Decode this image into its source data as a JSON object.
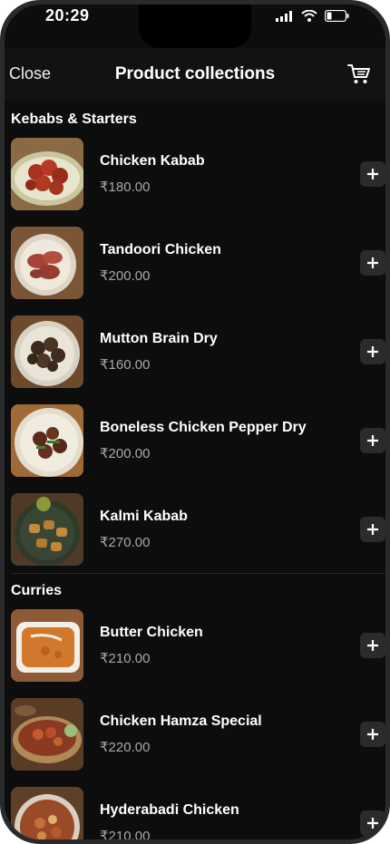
{
  "status_bar": {
    "time": "20:29"
  },
  "header": {
    "close_label": "Close",
    "title": "Product collections",
    "cart_icon": "cart-icon"
  },
  "sections": [
    {
      "title": "Kebabs & Starters",
      "items": [
        {
          "name": "Chicken Kabab",
          "price": "₹180.00"
        },
        {
          "name": "Tandoori Chicken",
          "price": "₹200.00"
        },
        {
          "name": "Mutton Brain Dry",
          "price": "₹160.00"
        },
        {
          "name": "Boneless Chicken Pepper Dry",
          "price": "₹200.00"
        },
        {
          "name": "Kalmi Kabab",
          "price": "₹270.00"
        }
      ]
    },
    {
      "title": "Curries",
      "items": [
        {
          "name": "Butter Chicken",
          "price": "₹210.00"
        },
        {
          "name": "Chicken Hamza Special",
          "price": "₹220.00"
        },
        {
          "name": "Hyderabadi Chicken",
          "price": "₹210.00"
        }
      ]
    }
  ],
  "icons": {
    "add": "plus-icon"
  }
}
